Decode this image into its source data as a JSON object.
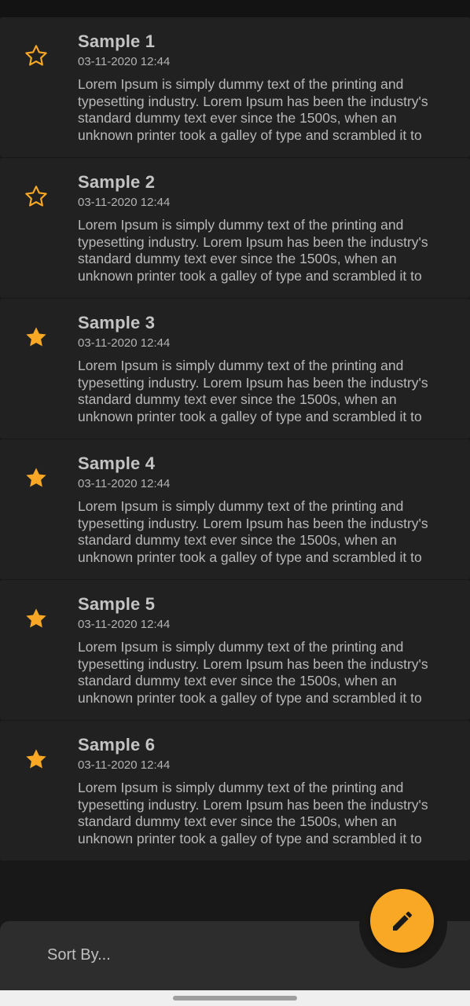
{
  "notes": [
    {
      "title": "Sample 1",
      "date": "03-11-2020 12:44",
      "body": "Lorem Ipsum is simply dummy text of the printing and typesetting industry. Lorem Ipsum has been the industry's standard dummy text ever since the 1500s, when an unknown printer took a galley of type and scrambled it to",
      "starred": false
    },
    {
      "title": "Sample 2",
      "date": "03-11-2020 12:44",
      "body": "Lorem Ipsum is simply dummy text of the printing and typesetting industry. Lorem Ipsum has been the industry's standard dummy text ever since the 1500s, when an unknown printer took a galley of type and scrambled it to",
      "starred": false
    },
    {
      "title": "Sample 3",
      "date": "03-11-2020 12:44",
      "body": "Lorem Ipsum is simply dummy text of the printing and typesetting industry. Lorem Ipsum has been the industry's standard dummy text ever since the 1500s, when an unknown printer took a galley of type and scrambled it to",
      "starred": true
    },
    {
      "title": "Sample 4",
      "date": "03-11-2020 12:44",
      "body": "Lorem Ipsum is simply dummy text of the printing and typesetting industry. Lorem Ipsum has been the industry's standard dummy text ever since the 1500s, when an unknown printer took a galley of type and scrambled it to",
      "starred": true
    },
    {
      "title": "Sample 5",
      "date": "03-11-2020 12:44",
      "body": "Lorem Ipsum is simply dummy text of the printing and typesetting industry. Lorem Ipsum has been the industry's standard dummy text ever since the 1500s, when an unknown printer took a galley of type and scrambled it to",
      "starred": true
    },
    {
      "title": "Sample 6",
      "date": "03-11-2020 12:44",
      "body": "Lorem Ipsum is simply dummy text of the printing and typesetting industry. Lorem Ipsum has been the industry's standard dummy text ever since the 1500s, when an unknown printer took a galley of type and scrambled it to",
      "starred": true
    }
  ],
  "bottom_bar": {
    "sort_label": "Sort By..."
  },
  "fab": {
    "icon": "edit-icon"
  },
  "colors": {
    "accent": "#f9a825",
    "card": "#212121",
    "background": "#181818",
    "bottom_bar": "#2d2d2d"
  }
}
